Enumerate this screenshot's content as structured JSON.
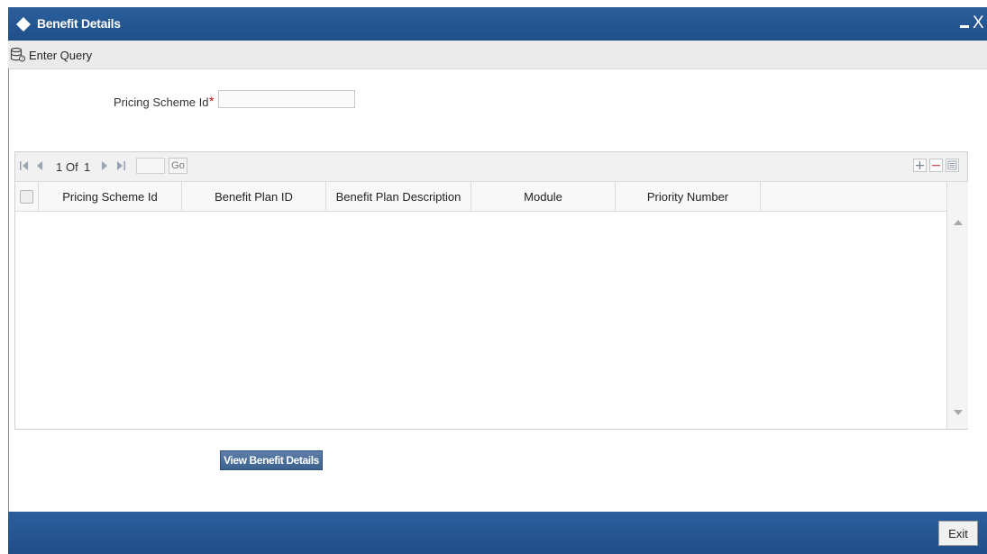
{
  "window": {
    "title": "Benefit Details"
  },
  "toolbar": {
    "enter_query_label": "Enter Query"
  },
  "form": {
    "pricing_scheme_label": "Pricing Scheme Id",
    "required_marker": "*",
    "pricing_scheme_value": ""
  },
  "grid": {
    "pager": {
      "current": "1",
      "of_label": "Of",
      "total": "1",
      "go_label": "Go",
      "go_value": ""
    },
    "columns": [
      "Pricing Scheme Id",
      "Benefit Plan ID",
      "Benefit Plan Description",
      "Module",
      "Priority Number"
    ],
    "rows": []
  },
  "actions": {
    "view_benefit_details_label": "View Benefit Details",
    "exit_label": "Exit"
  },
  "colors": {
    "title_bar": "#1f4f8a",
    "footer": "#1f4e89",
    "button": "#3c628f",
    "required": "#cc0000"
  },
  "icons": [
    "diamond-icon",
    "enter-query-icon",
    "first-page-icon",
    "prev-page-icon",
    "next-page-icon",
    "last-page-icon",
    "add-row-icon",
    "delete-row-icon",
    "single-view-icon"
  ]
}
